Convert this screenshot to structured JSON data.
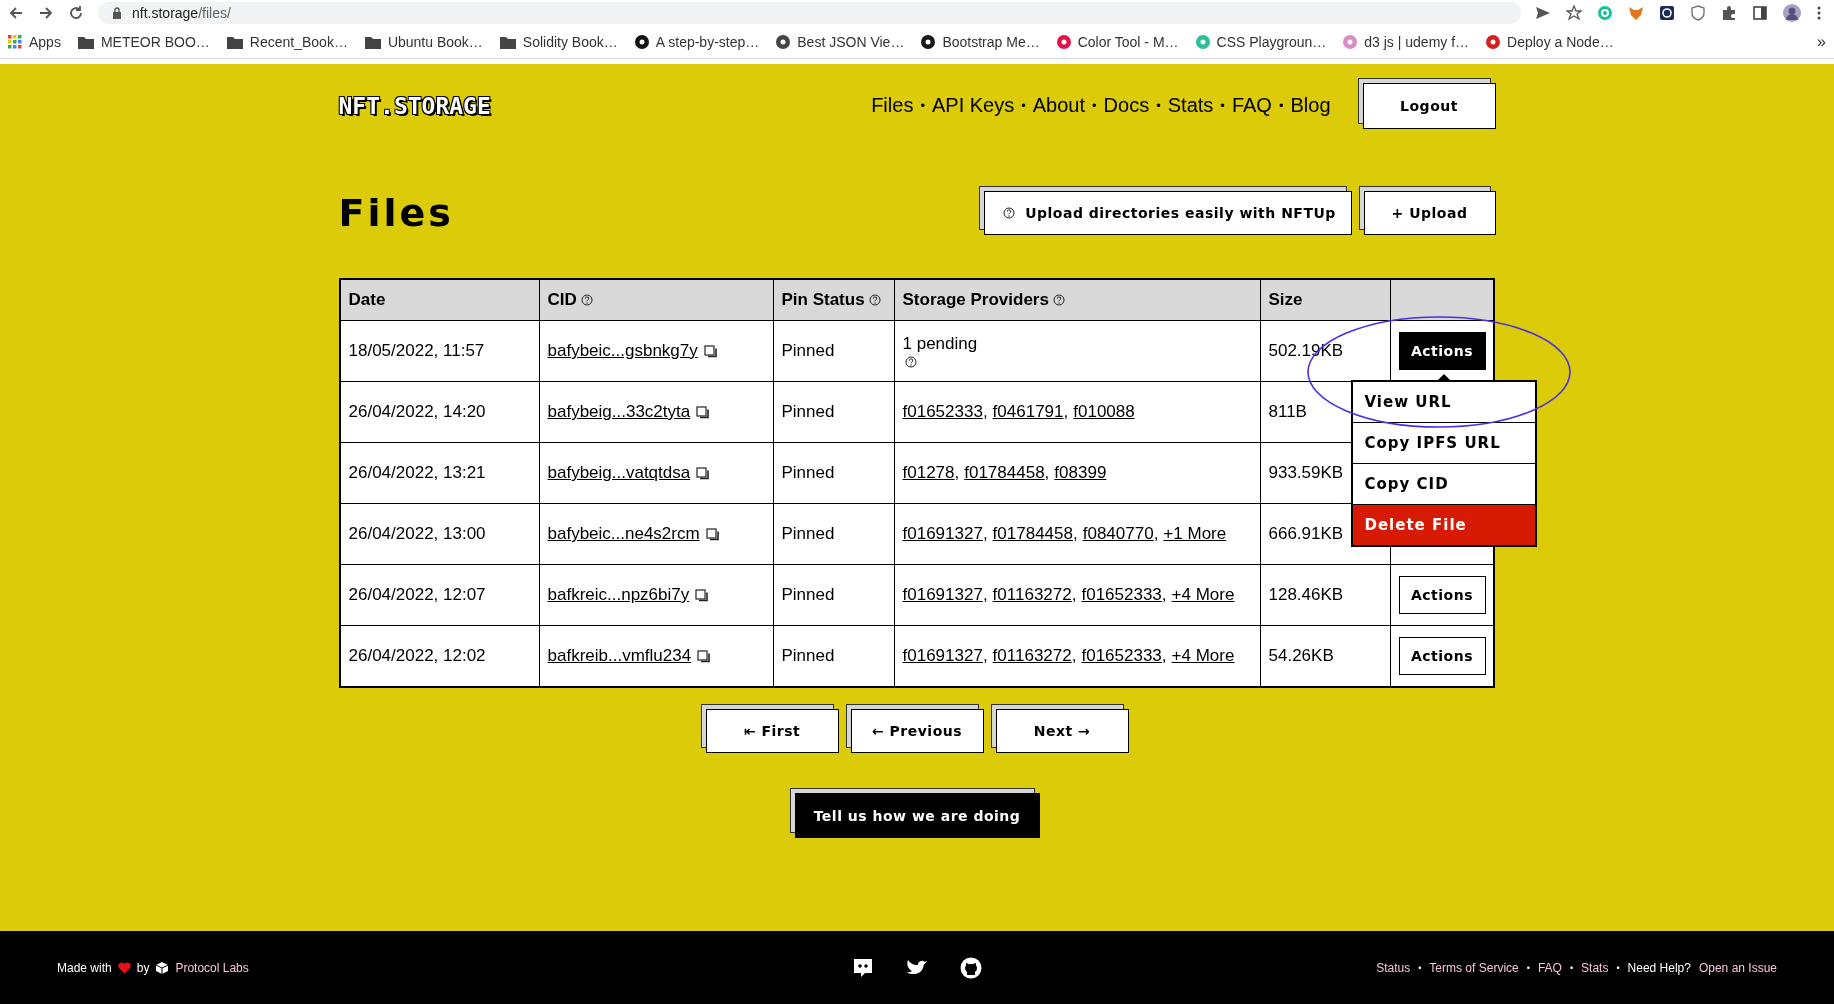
{
  "browser": {
    "url_host": "nft.storage",
    "url_path": "/files/",
    "bookmarks": [
      {
        "label": "Apps",
        "kind": "apps"
      },
      {
        "label": "METEOR BOO…",
        "kind": "folder"
      },
      {
        "label": "Recent_Book…",
        "kind": "folder"
      },
      {
        "label": "Ubuntu Book…",
        "kind": "folder"
      },
      {
        "label": "Solidity Book…",
        "kind": "folder"
      },
      {
        "label": "A step-by-step…",
        "kind": "site",
        "color": "#111111"
      },
      {
        "label": "Best JSON Vie…",
        "kind": "site",
        "color": "#444444"
      },
      {
        "label": "Bootstrap Me…",
        "kind": "site",
        "color": "#1a1a1a"
      },
      {
        "label": "Color Tool - M…",
        "kind": "site",
        "color": "#e0134d"
      },
      {
        "label": "CSS Playgroun…",
        "kind": "site",
        "color": "#2bbf9a"
      },
      {
        "label": "d3 js | udemy f…",
        "kind": "site",
        "color": "#d98cc8"
      },
      {
        "label": "Deploy a Node…",
        "kind": "site",
        "color": "#d62020"
      }
    ],
    "overflow": "»"
  },
  "header": {
    "logo": "NFT.STORAGE",
    "separator": "•",
    "nav": [
      "Files",
      "API Keys",
      "About",
      "Docs",
      "Stats",
      "FAQ",
      "Blog"
    ],
    "logout": "Logout"
  },
  "page": {
    "title": "Files",
    "buttons": [
      {
        "label": "Upload directories easily with NFTUp",
        "help": true
      },
      {
        "label": "+ Upload",
        "help": false
      }
    ]
  },
  "table": {
    "separator": ",",
    "columns": [
      {
        "label": "Date",
        "help": false
      },
      {
        "label": "CID",
        "help": true
      },
      {
        "label": "Pin Status",
        "help": true
      },
      {
        "label": "Storage Providers",
        "help": true
      },
      {
        "label": "Size",
        "help": false
      }
    ],
    "rows": [
      {
        "date": "18/05/2022, 11:57",
        "cid": "bafybeic...gsbnkg7y",
        "pin_status": "Pinned",
        "pending": "1 pending",
        "providers": [],
        "size": "502.19KB",
        "action": {
          "label": "Actions",
          "active": true
        }
      },
      {
        "date": "26/04/2022, 14:20",
        "cid": "bafybeig...33c2tyta",
        "pin_status": "Pinned",
        "providers": [
          "f01652333",
          "f0461791",
          "f010088"
        ],
        "size": "811B"
      },
      {
        "date": "26/04/2022, 13:21",
        "cid": "bafybeig...vatqtdsa",
        "pin_status": "Pinned",
        "providers": [
          "f01278",
          "f01784458",
          "f08399"
        ],
        "size": "933.59KB"
      },
      {
        "date": "26/04/2022, 13:00",
        "cid": "bafybeic...ne4s2rcm",
        "pin_status": "Pinned",
        "providers": [
          "f01691327",
          "f01784458",
          "f0840770"
        ],
        "more": "+1 More",
        "size": "666.91KB"
      },
      {
        "date": "26/04/2022, 12:07",
        "cid": "bafkreic...npz6bi7y",
        "pin_status": "Pinned",
        "providers": [
          "f01691327",
          "f01163272",
          "f01652333"
        ],
        "more": "+4 More",
        "size": "128.46KB",
        "action": {
          "label": "Actions",
          "active": false
        }
      },
      {
        "date": "26/04/2022, 12:02",
        "cid": "bafkreib...vmflu234",
        "pin_status": "Pinned",
        "providers": [
          "f01691327",
          "f01163272",
          "f01652333"
        ],
        "more": "+4 More",
        "size": "54.26KB",
        "action": {
          "label": "Actions",
          "active": false
        }
      }
    ],
    "menu": [
      {
        "label": "View URL",
        "kind": "normal"
      },
      {
        "label": "Copy IPFS URL",
        "kind": "normal"
      },
      {
        "label": "Copy CID",
        "kind": "normal"
      },
      {
        "label": "Delete File",
        "kind": "danger"
      }
    ]
  },
  "pagination": [
    "⇤ First",
    "← Previous",
    "Next →"
  ],
  "feedback": "Tell us how we are doing",
  "footer": {
    "separator": "•",
    "made_with": "Made with",
    "by": "by",
    "org": "Protocol Labs",
    "links": [
      "Status",
      "Terms of Service",
      "FAQ",
      "Stats"
    ],
    "help_label": "Need Help?",
    "help_link": "Open an Issue"
  }
}
